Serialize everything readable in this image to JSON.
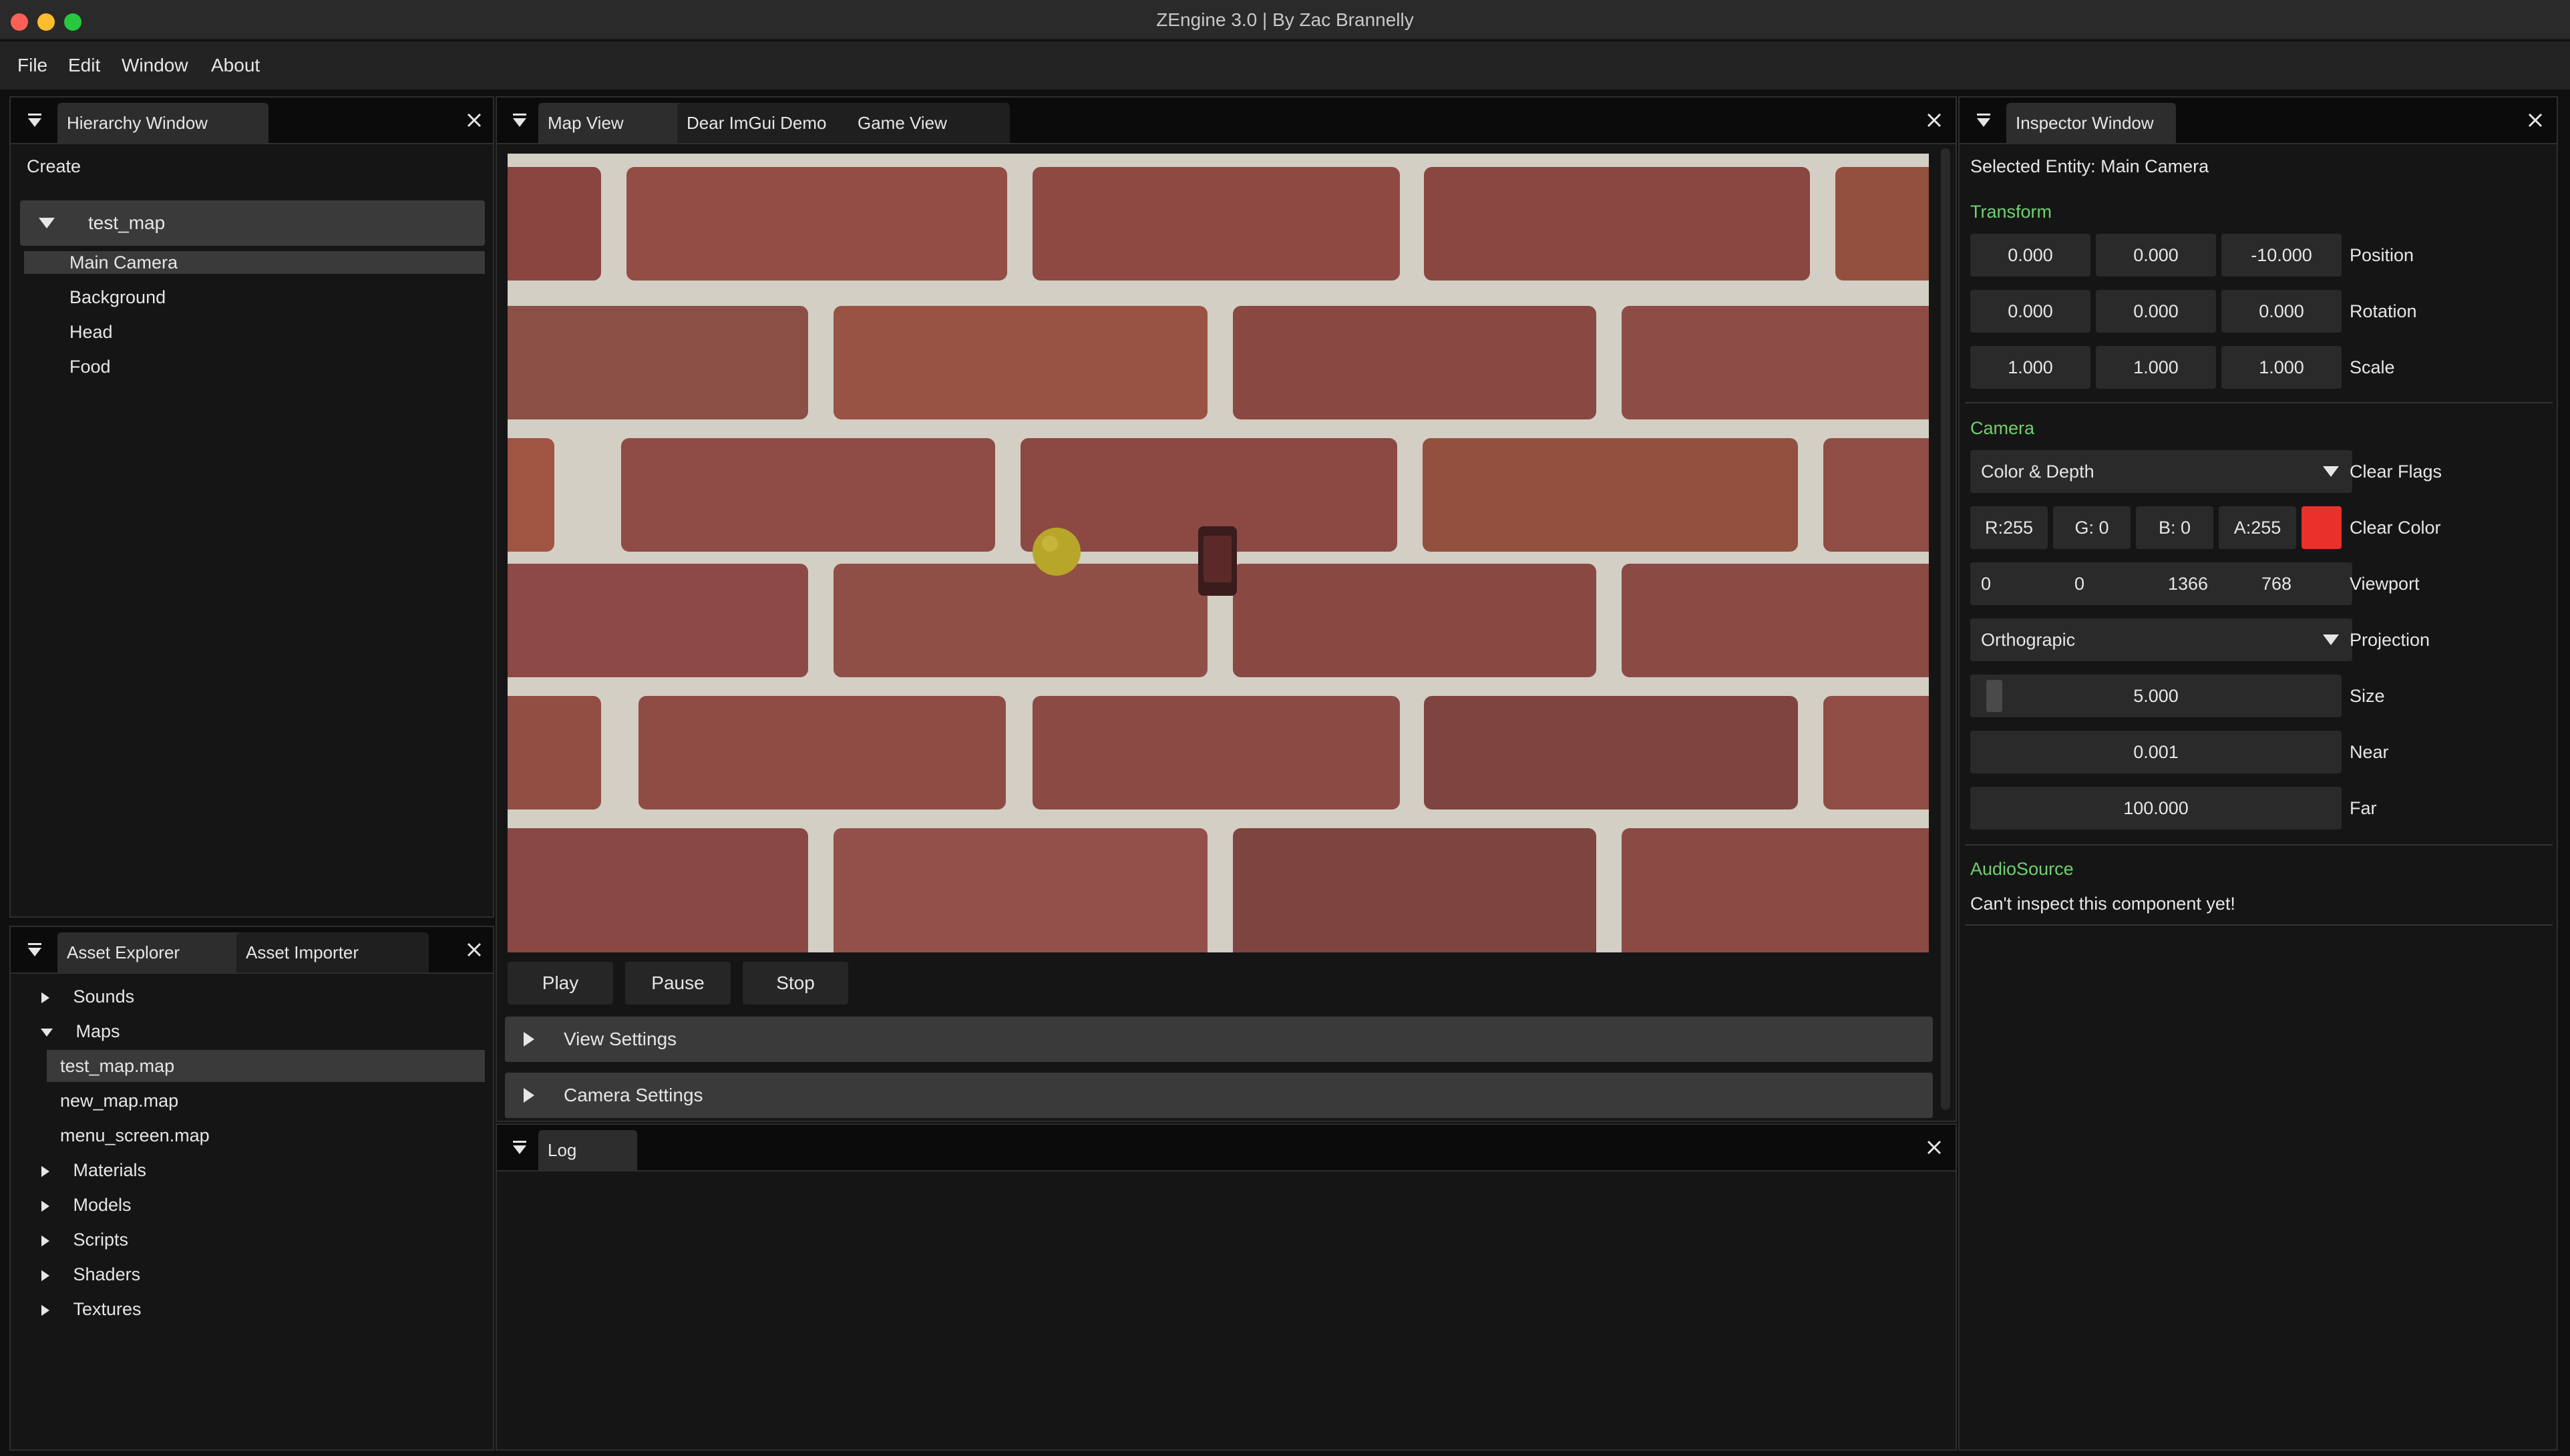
{
  "window": {
    "title": "ZEngine 3.0 | By Zac Brannelly",
    "traffic_colors": [
      "#fe5f57",
      "#febc2e",
      "#28c840"
    ]
  },
  "menubar": {
    "items": [
      "File",
      "Edit",
      "Window",
      "About"
    ]
  },
  "hierarchy": {
    "tab_label": "Hierarchy Window",
    "create_label": "Create",
    "root_label": "test_map",
    "entities": [
      "Main Camera",
      "Background",
      "Head",
      "Food"
    ],
    "selected": "Main Camera"
  },
  "assets": {
    "tabs": [
      "Asset Explorer",
      "Asset Importer"
    ],
    "tree": [
      {
        "label": "Sounds",
        "expanded": false
      },
      {
        "label": "Maps",
        "expanded": true
      },
      {
        "label": "test_map.map",
        "child": true,
        "selected": true
      },
      {
        "label": "new_map.map",
        "child": true
      },
      {
        "label": "menu_screen.map",
        "child": true
      },
      {
        "label": "Materials",
        "expanded": false
      },
      {
        "label": "Models",
        "expanded": false
      },
      {
        "label": "Scripts",
        "expanded": false
      },
      {
        "label": "Shaders",
        "expanded": false
      },
      {
        "label": "Textures",
        "expanded": false
      }
    ]
  },
  "center": {
    "tabs": [
      "Map View",
      "Dear ImGui Demo",
      "Game View"
    ],
    "buttons": {
      "play": "Play",
      "pause": "Pause",
      "stop": "Stop"
    },
    "collapsing": {
      "view_settings": "View Settings",
      "camera_settings": "Camera Settings"
    },
    "brick_color": "#8a4a3f",
    "mortar_color": "#d6d2c8",
    "food_color": "#b8a62a"
  },
  "log": {
    "tab_label": "Log"
  },
  "inspector": {
    "tab_label": "Inspector Window",
    "selected_entity": "Selected Entity: Main Camera",
    "transform": {
      "header": "Transform",
      "position": {
        "label": "Position",
        "values": [
          "0.000",
          "0.000",
          "-10.000"
        ]
      },
      "rotation": {
        "label": "Rotation",
        "values": [
          "0.000",
          "0.000",
          "0.000"
        ]
      },
      "scale": {
        "label": "Scale",
        "values": [
          "1.000",
          "1.000",
          "1.000"
        ]
      }
    },
    "camera": {
      "header": "Camera",
      "clear_flags": {
        "value": "Color & Depth",
        "label": "Clear Flags"
      },
      "clear_color": {
        "r": "R:255",
        "g": "G:  0",
        "b": "B:  0",
        "a": "A:255",
        "label": "Clear Color",
        "swatch": "#e8312a"
      },
      "viewport": {
        "values": [
          "0",
          "0",
          "1366",
          "768"
        ],
        "label": "Viewport"
      },
      "projection": {
        "value": "Orthograpic",
        "label": "Projection"
      },
      "size": {
        "value": "5.000",
        "label": "Size"
      },
      "near": {
        "value": "0.001",
        "label": "Near"
      },
      "far": {
        "value": "100.000",
        "label": "Far"
      }
    },
    "audio": {
      "header": "AudioSource",
      "message": "Can't inspect this component yet!"
    },
    "section_color": "#6fd16f"
  }
}
